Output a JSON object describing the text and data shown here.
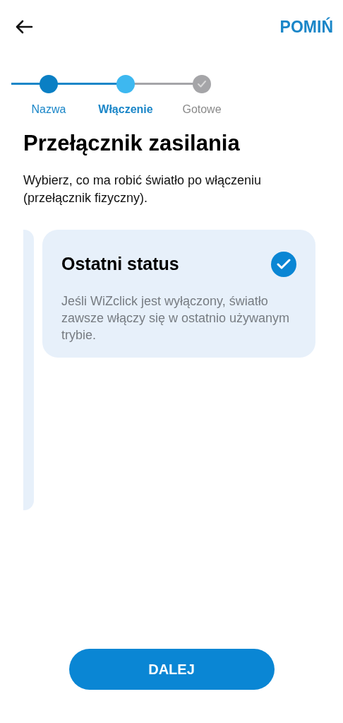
{
  "header": {
    "skip_label": "POMIŃ"
  },
  "steps": [
    {
      "label": "Nazwa",
      "kind": "done",
      "selected": false
    },
    {
      "label": "Włączenie",
      "kind": "current",
      "selected": true
    },
    {
      "label": "Gotowe",
      "kind": "pending",
      "selected": false
    }
  ],
  "title": "Przełącznik zasilania",
  "description": "Wybierz, co ma robić światło po włączeniu (przełącznik fizyczny).",
  "options": [
    {
      "title": "Ostatni status",
      "description": "Jeśli WiZclick jest wyłączony, światło zawsze włączy się w ostatnio używanym trybie.",
      "selected": true
    }
  ],
  "next_button": "DALEJ"
}
